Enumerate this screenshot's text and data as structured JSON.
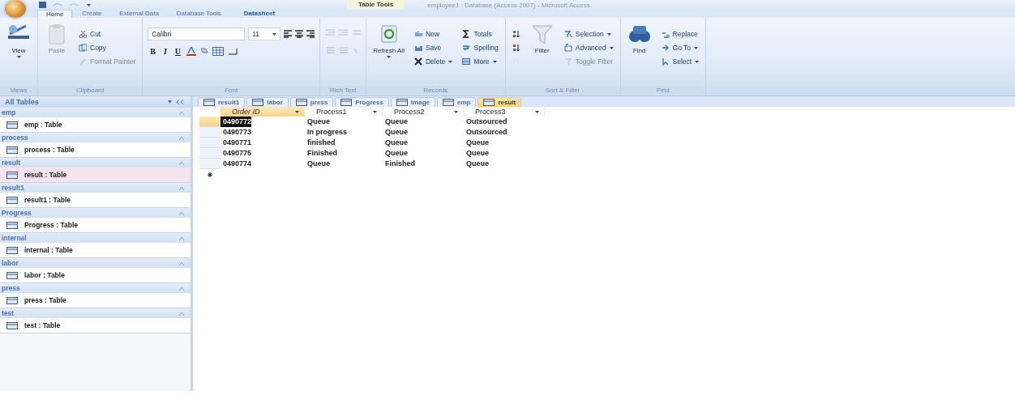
{
  "title_bar": {
    "contextual_label": "Table Tools",
    "title": "employee1 : Database (Access 2007) - Microsoft Access"
  },
  "ribbon_tabs": [
    {
      "label": "Home",
      "selected": true,
      "kind": "normal"
    },
    {
      "label": "Create",
      "selected": false,
      "kind": "normal"
    },
    {
      "label": "External Data",
      "selected": false,
      "kind": "normal"
    },
    {
      "label": "Database Tools",
      "selected": false,
      "kind": "normal"
    },
    {
      "label": "Datasheet",
      "selected": false,
      "kind": "contextual"
    }
  ],
  "ribbon_groups": [
    {
      "label": "Views",
      "kind": "buttons",
      "items": [
        {
          "label": "View",
          "kind": "large",
          "disabled": false,
          "dropdown": true
        }
      ]
    },
    {
      "label": "Clipboard",
      "kind": "buttons",
      "items": [
        {
          "label": "Paste",
          "kind": "large",
          "disabled": true,
          "dropdown": false
        },
        {
          "label": "Cut",
          "kind": "small",
          "disabled": false,
          "dropdown": false
        },
        {
          "label": "Copy",
          "kind": "small",
          "disabled": false,
          "dropdown": false
        },
        {
          "label": "Format Painter",
          "kind": "small",
          "disabled": true,
          "dropdown": false
        }
      ]
    },
    {
      "label": "Font",
      "kind": "font",
      "font": "Calibri",
      "size": "11",
      "styles": [
        "B",
        "I",
        "U"
      ]
    },
    {
      "label": "Rich Text",
      "kind": "richtext"
    },
    {
      "label": "Records",
      "kind": "buttons",
      "items": [
        {
          "label": "Refresh All",
          "kind": "large",
          "disabled": false,
          "dropdown": true
        },
        {
          "label": "New",
          "kind": "small",
          "disabled": false,
          "dropdown": false
        },
        {
          "label": "Save",
          "kind": "small",
          "disabled": false,
          "dropdown": false
        },
        {
          "label": "Delete",
          "kind": "small",
          "disabled": false,
          "dropdown": true
        },
        {
          "label": "Totals",
          "kind": "small",
          "disabled": false,
          "dropdown": false
        },
        {
          "label": "Spelling",
          "kind": "small",
          "disabled": false,
          "dropdown": false
        },
        {
          "label": "More",
          "kind": "small",
          "disabled": false,
          "dropdown": true
        }
      ]
    },
    {
      "label": "Sort & Filter",
      "kind": "buttons",
      "items": [
        {
          "kind": "icon",
          "disabled": false
        },
        {
          "kind": "icon",
          "disabled": false
        },
        {
          "kind": "icon",
          "disabled": true
        },
        {
          "label": "Filter",
          "kind": "large",
          "disabled": false,
          "dropdown": false
        },
        {
          "label": "Selection",
          "kind": "small",
          "disabled": false,
          "dropdown": true
        },
        {
          "label": "Advanced",
          "kind": "small",
          "disabled": false,
          "dropdown": true
        },
        {
          "label": "Toggle Filter",
          "kind": "small",
          "disabled": true,
          "dropdown": false
        }
      ]
    },
    {
      "label": "Find",
      "kind": "buttons",
      "items": [
        {
          "label": "Find",
          "kind": "large",
          "disabled": false,
          "dropdown": false
        },
        {
          "label": "Replace",
          "kind": "small",
          "disabled": false,
          "dropdown": false
        },
        {
          "label": "Go To",
          "kind": "small",
          "disabled": false,
          "dropdown": true
        },
        {
          "label": "Select",
          "kind": "small",
          "disabled": false,
          "dropdown": true
        }
      ]
    }
  ],
  "nav_pane": {
    "header": "All Tables",
    "groups": [
      {
        "name": "emp",
        "items": [
          {
            "label": "emp : Table",
            "selected": false
          }
        ]
      },
      {
        "name": "process",
        "items": [
          {
            "label": "process : Table",
            "selected": false
          }
        ]
      },
      {
        "name": "result",
        "items": [
          {
            "label": "result : Table",
            "selected": true
          }
        ]
      },
      {
        "name": "result1",
        "items": [
          {
            "label": "result1 : Table",
            "selected": false
          }
        ]
      },
      {
        "name": "Progress",
        "items": [
          {
            "label": "Progress : Table",
            "selected": false
          }
        ]
      },
      {
        "name": "internal",
        "items": [
          {
            "label": "internal : Table",
            "selected": false
          }
        ]
      },
      {
        "name": "labor",
        "items": [
          {
            "label": "labor : Table",
            "selected": false
          }
        ]
      },
      {
        "name": "press",
        "items": [
          {
            "label": "press : Table",
            "selected": false
          }
        ]
      },
      {
        "name": "test",
        "items": [
          {
            "label": "test : Table",
            "selected": false
          }
        ]
      }
    ]
  },
  "document_tabs": [
    {
      "label": "result1",
      "selected": false
    },
    {
      "label": "labor",
      "selected": false
    },
    {
      "label": "press",
      "selected": false
    },
    {
      "label": "Progress",
      "selected": false
    },
    {
      "label": "Image",
      "selected": false
    },
    {
      "label": "emp",
      "selected": false
    },
    {
      "label": "result",
      "selected": true
    }
  ],
  "table": {
    "columns": [
      {
        "label": "Order ID",
        "selected": true
      },
      {
        "label": "Process1",
        "selected": false
      },
      {
        "label": "Process2",
        "selected": false
      },
      {
        "label": "Process3",
        "selected": false
      }
    ],
    "rows": [
      {
        "cells": [
          "0490772",
          "Queue",
          "Queue",
          "Outsourced"
        ],
        "selected": true
      },
      {
        "cells": [
          "0490773",
          "In progress",
          "Queue",
          "Outsourced"
        ],
        "selected": false
      },
      {
        "cells": [
          "0490771",
          "finished",
          "Queue",
          "Queue"
        ],
        "selected": false
      },
      {
        "cells": [
          "0490775",
          "Finished",
          "Queue",
          "Queue"
        ],
        "selected": false
      },
      {
        "cells": [
          "0490774",
          "Queue",
          "Finished",
          "Queue"
        ],
        "selected": false
      }
    ]
  }
}
